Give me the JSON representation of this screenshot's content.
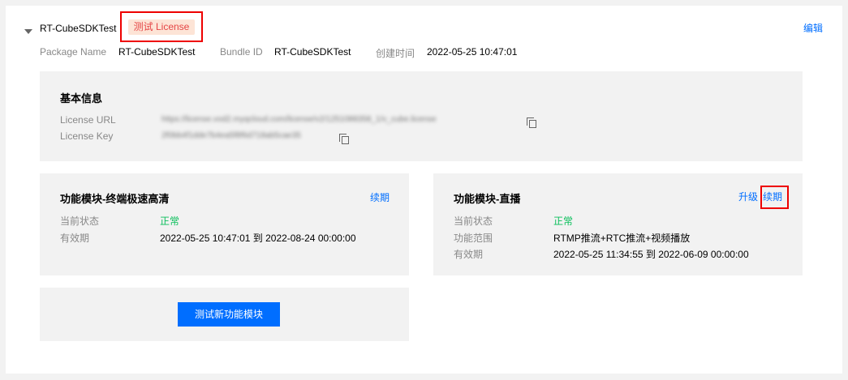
{
  "app": {
    "name": "RT-CubeSDKTest",
    "tag": "测试 License",
    "edit_label": "编辑"
  },
  "meta": {
    "package_label": "Package Name",
    "package_value": "RT-CubeSDKTest",
    "bundle_label": "Bundle ID",
    "bundle_value": "RT-CubeSDKTest",
    "created_label": "创建时间",
    "created_value": "2022-05-25 10:47:01"
  },
  "basic": {
    "title": "基本信息",
    "url_label": "License URL",
    "url_value": "https://license.vod2.myqcloud.com/license/v2/1251088358_1/v_cube.license",
    "key_label": "License Key",
    "key_value": "2f0bb4f1dde7b4ea5f8f6d718ab5cae35"
  },
  "module1": {
    "title": "功能模块-终端极速高清",
    "renew_label": "续期",
    "status_label": "当前状态",
    "status_value": "正常",
    "validity_label": "有效期",
    "validity_value": "2022-05-25 10:47:01 到 2022-08-24 00:00:00"
  },
  "module2": {
    "title": "功能模块-直播",
    "upgrade_label": "升级",
    "renew_label": "续期",
    "status_label": "当前状态",
    "status_value": "正常",
    "scope_label": "功能范围",
    "scope_value": "RTMP推流+RTC推流+视频播放",
    "validity_label": "有效期",
    "validity_value": "2022-05-25 11:34:55 到 2022-06-09 00:00:00"
  },
  "new_module": {
    "button_label": "测试新功能模块"
  },
  "colors": {
    "accent": "#006eff",
    "status_ok": "#0abf5b",
    "tag_bg": "#fde4d6",
    "tag_text": "#e54545",
    "highlight_border": "#ee0000"
  },
  "icons": [
    "caret-down-icon",
    "copy-icon"
  ]
}
